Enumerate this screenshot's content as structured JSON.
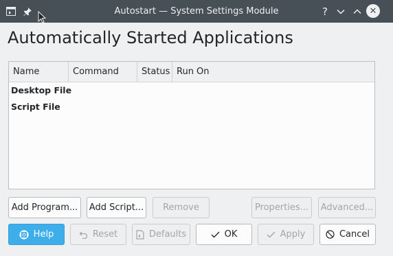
{
  "window": {
    "title": "Autostart — System Settings Module",
    "help_glyph": "?",
    "minimize_glyph": "⌄",
    "maximize_glyph": "⌃",
    "close_glyph": "✕"
  },
  "page": {
    "title": "Automatically Started Applications"
  },
  "table": {
    "columns": [
      "Name",
      "Command",
      "Status",
      "Run On"
    ],
    "rows": [
      "Desktop File",
      "Script File"
    ]
  },
  "actions": {
    "add_program": "Add Program...",
    "add_script": "Add Script...",
    "remove": "Remove",
    "properties": "Properties...",
    "advanced": "Advanced..."
  },
  "dialog_buttons": {
    "help": "Help",
    "reset": "Reset",
    "defaults": "Defaults",
    "ok": "OK",
    "apply": "Apply",
    "cancel": "Cancel"
  },
  "colors": {
    "titlebar": "#475057",
    "accent": "#3daee9",
    "background": "#eff0f1"
  }
}
